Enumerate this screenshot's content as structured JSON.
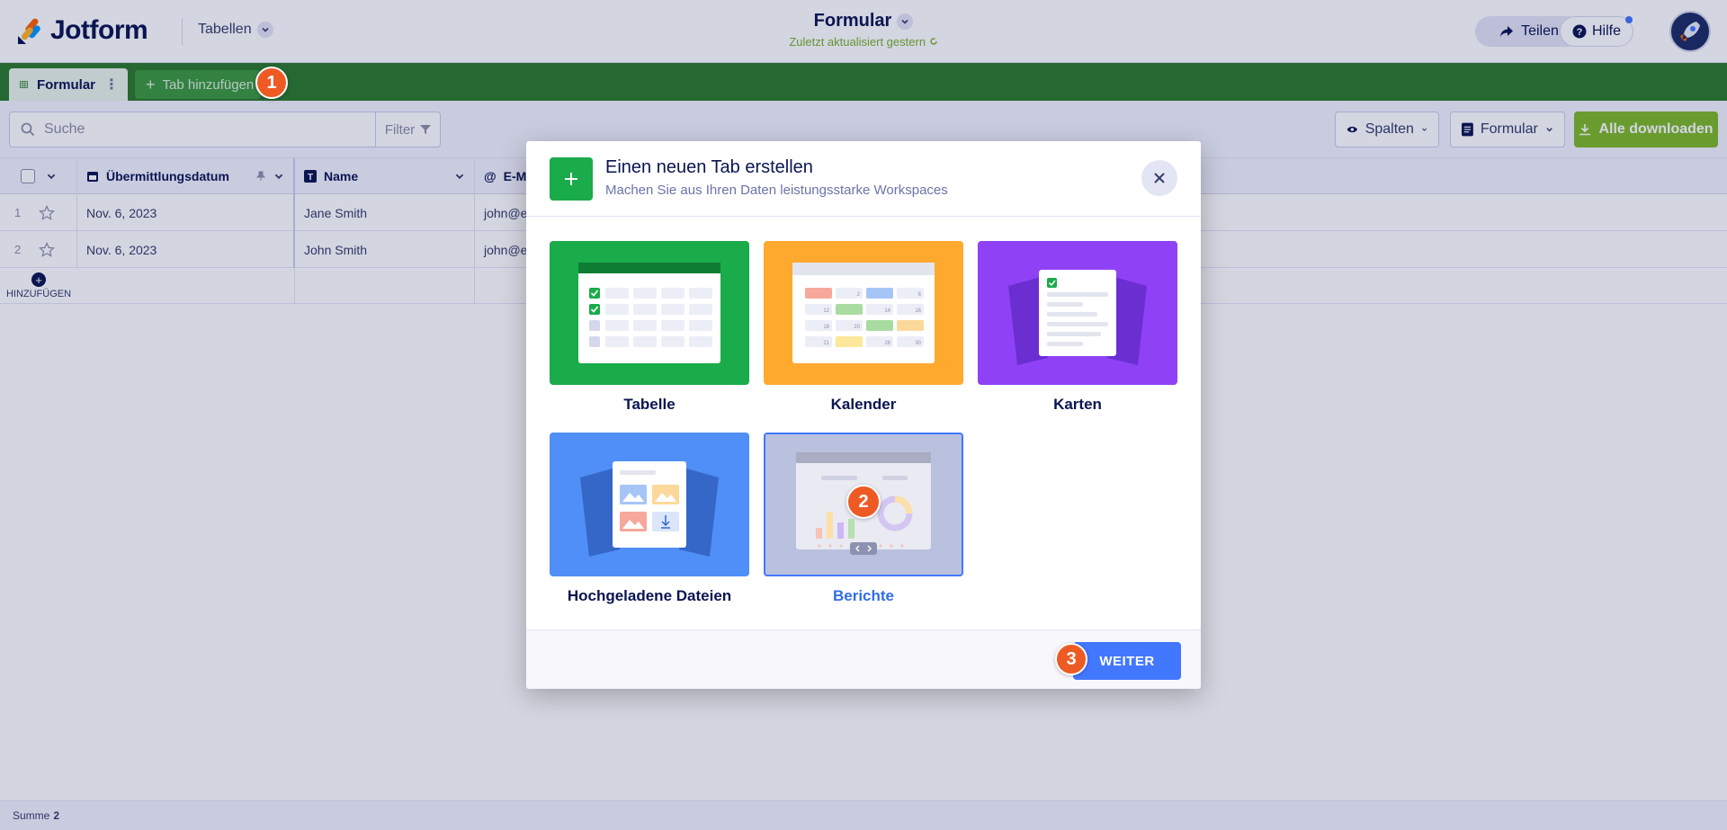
{
  "topbar": {
    "brand": "Jotform",
    "tables_menu": "Tabellen",
    "form_title": "Formular",
    "updated": "Zuletzt aktualisiert gestern",
    "share": "Teilen",
    "help": "Hilfe"
  },
  "tabs": {
    "active": "Formular",
    "add": "Tab hinzufügen"
  },
  "toolbar": {
    "search_placeholder": "Suche",
    "filter": "Filter",
    "columns": "Spalten",
    "form": "Formular",
    "download_all": "Alle downloaden"
  },
  "table": {
    "headers": [
      "Übermittlungsdatum",
      "Name",
      "E-M"
    ],
    "rows": [
      {
        "num": "1",
        "date": "Nov. 6, 2023",
        "name": "Jane Smith",
        "email": "john@e"
      },
      {
        "num": "2",
        "date": "Nov. 6, 2023",
        "name": "John Smith",
        "email": "john@e"
      }
    ],
    "add_label": "HINZUFÜGEN",
    "footer_label": "Summe",
    "footer_count": "2"
  },
  "modal": {
    "title": "Einen neuen Tab erstellen",
    "subtitle": "Machen Sie aus Ihren Daten leistungsstarke Workspaces",
    "options": [
      {
        "label": "Tabelle",
        "color": "#1aab4b"
      },
      {
        "label": "Kalender",
        "color": "#ffa92e"
      },
      {
        "label": "Karten",
        "color": "#8f42f5"
      },
      {
        "label": "Hochgeladene Dateien",
        "color": "#4f8ff7"
      },
      {
        "label": "Berichte",
        "color": "#b9c1de"
      }
    ],
    "selected": "Berichte",
    "next": "WEITER",
    "calendar_numbers": [
      "2",
      "6",
      "12",
      "14",
      "16",
      "18",
      "20",
      "21",
      "28",
      "30"
    ]
  },
  "steps": [
    "1",
    "2",
    "3"
  ]
}
